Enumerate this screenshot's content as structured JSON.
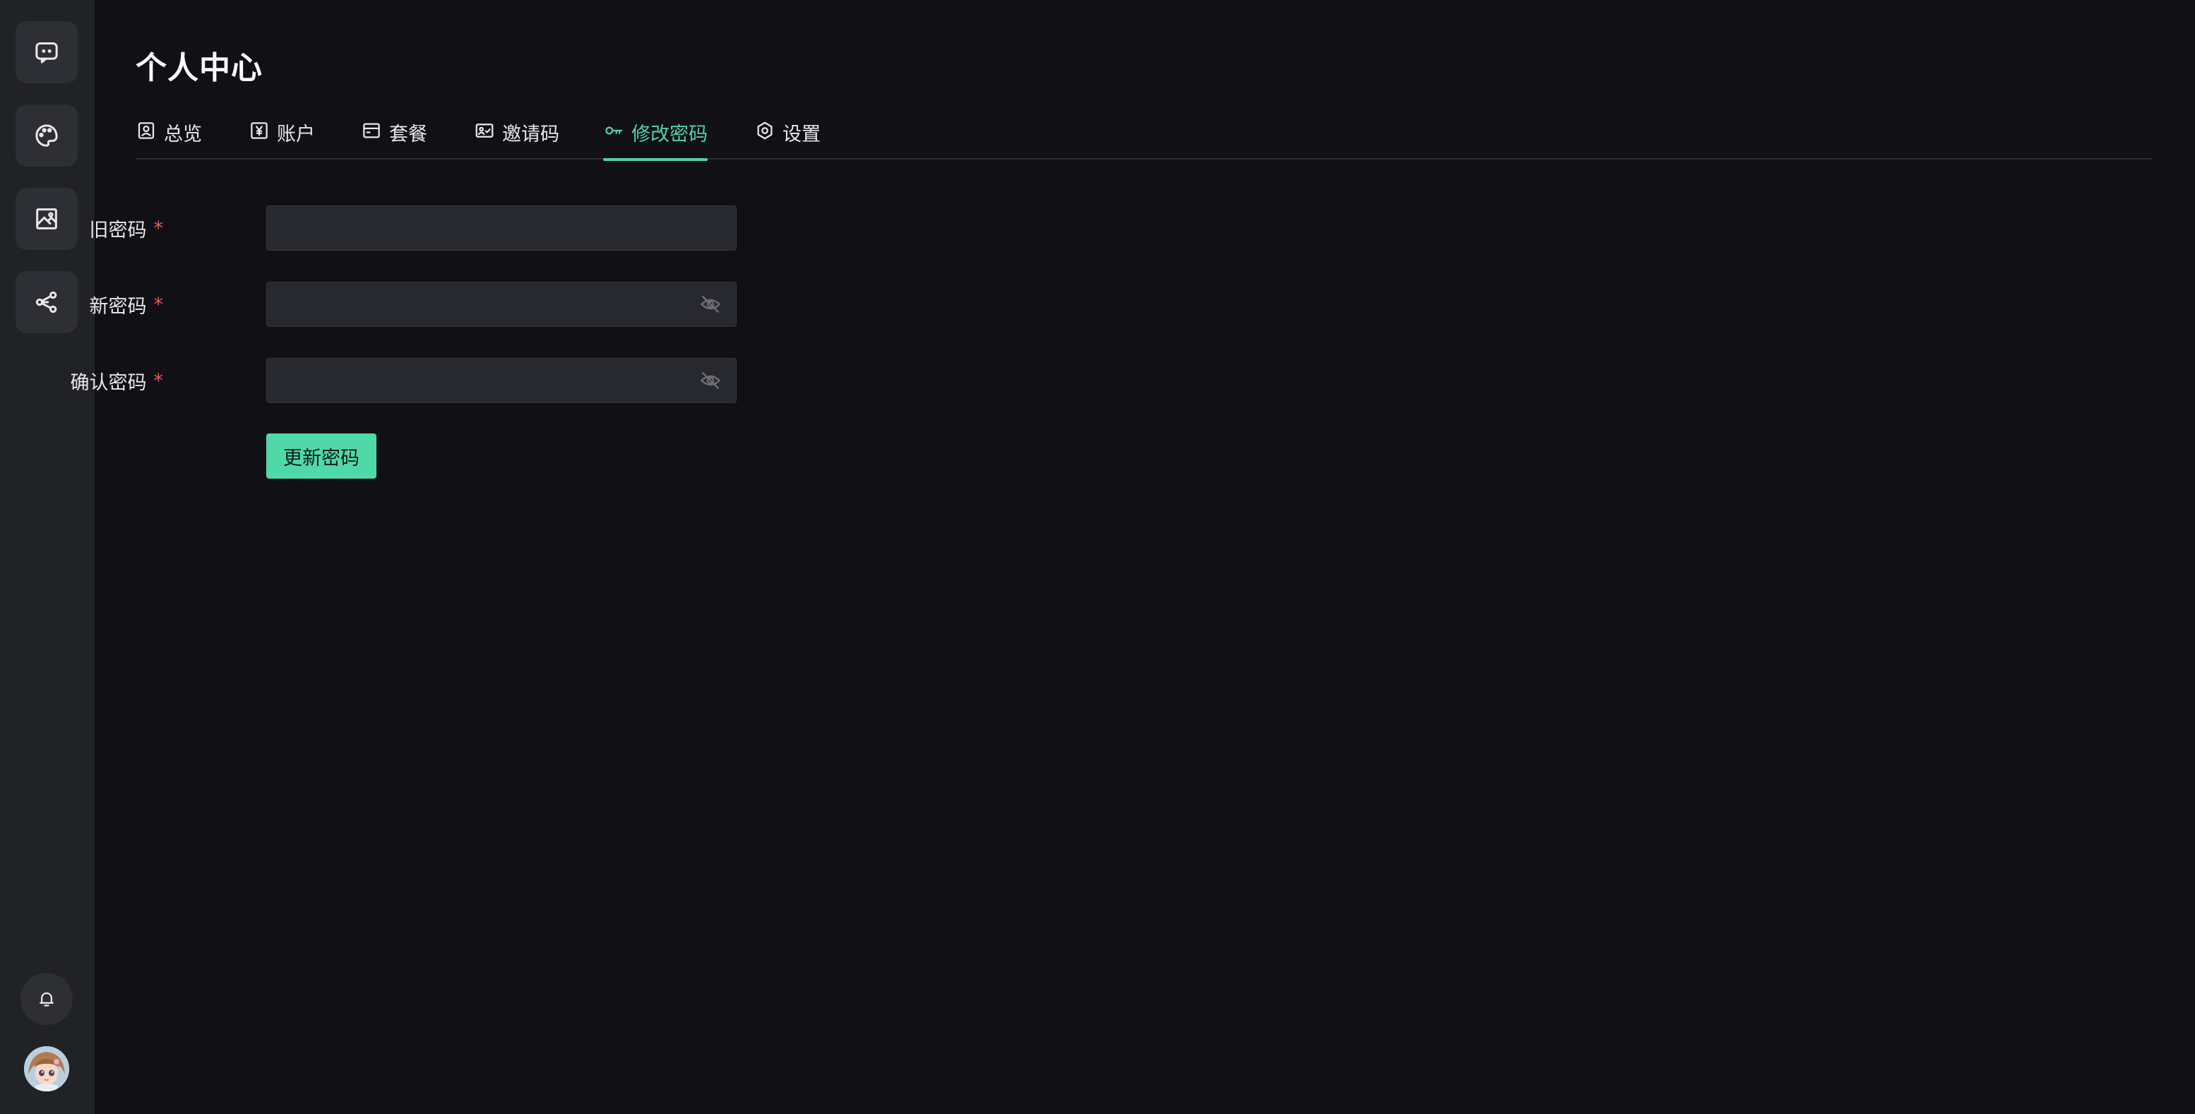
{
  "sidebar": {
    "items": [
      {
        "icon": "chat-icon"
      },
      {
        "icon": "palette-icon"
      },
      {
        "icon": "image-icon"
      },
      {
        "icon": "share-icon"
      }
    ],
    "bottom": {
      "notification_icon": "bell-icon",
      "avatar": "user-avatar"
    }
  },
  "page": {
    "title": "个人中心"
  },
  "tabs": [
    {
      "label": "总览",
      "icon": "user-card-icon"
    },
    {
      "label": "账户",
      "icon": "yen-icon"
    },
    {
      "label": "套餐",
      "icon": "package-icon"
    },
    {
      "label": "邀请码",
      "icon": "id-card-icon"
    },
    {
      "label": "修改密码",
      "icon": "key-icon",
      "active": true
    },
    {
      "label": "设置",
      "icon": "gear-icon"
    }
  ],
  "form": {
    "old_password": {
      "label": "旧密码",
      "required_mark": "*",
      "value": ""
    },
    "new_password": {
      "label": "新密码",
      "required_mark": "*",
      "value": ""
    },
    "confirm_password": {
      "label": "确认密码",
      "required_mark": "*",
      "value": ""
    },
    "submit_label": "更新密码"
  },
  "colors": {
    "accent": "#4fd2a6",
    "background": "#111115",
    "sidebar": "#212226",
    "required": "#e05a5a"
  }
}
